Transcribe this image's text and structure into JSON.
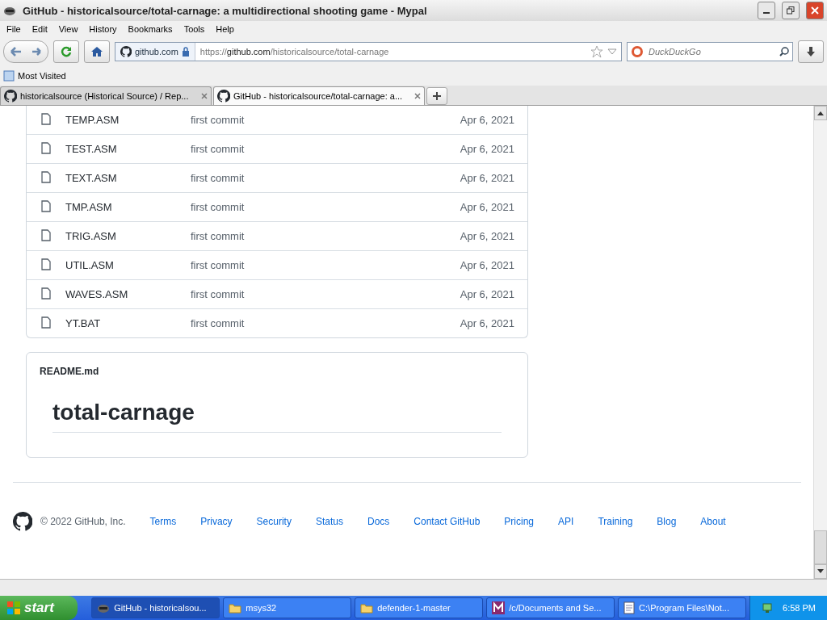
{
  "window": {
    "title": "GitHub - historicalsource/total-carnage: a multidirectional shooting game - Mypal"
  },
  "menu": [
    "File",
    "Edit",
    "View",
    "History",
    "Bookmarks",
    "Tools",
    "Help"
  ],
  "address": {
    "site": "github.com",
    "url_prefix": "https://",
    "url_host": "github.com",
    "url_path": "/historicalsource/total-carnage"
  },
  "search": {
    "placeholder": "DuckDuckGo"
  },
  "bookmarks": [
    "Most Visited"
  ],
  "tabs": [
    {
      "label": "historicalsource (Historical Source) / Rep...",
      "selected": false
    },
    {
      "label": "GitHub - historicalsource/total-carnage: a...",
      "selected": true
    }
  ],
  "files": [
    {
      "name": "TEMP.ASM",
      "message": "first commit",
      "date": "Apr 6, 2021"
    },
    {
      "name": "TEST.ASM",
      "message": "first commit",
      "date": "Apr 6, 2021"
    },
    {
      "name": "TEXT.ASM",
      "message": "first commit",
      "date": "Apr 6, 2021"
    },
    {
      "name": "TMP.ASM",
      "message": "first commit",
      "date": "Apr 6, 2021"
    },
    {
      "name": "TRIG.ASM",
      "message": "first commit",
      "date": "Apr 6, 2021"
    },
    {
      "name": "UTIL.ASM",
      "message": "first commit",
      "date": "Apr 6, 2021"
    },
    {
      "name": "WAVES.ASM",
      "message": "first commit",
      "date": "Apr 6, 2021"
    },
    {
      "name": "YT.BAT",
      "message": "first commit",
      "date": "Apr 6, 2021"
    }
  ],
  "readme": {
    "filename": "README.md",
    "heading": "total-carnage"
  },
  "footer": {
    "copyright": "© 2022 GitHub, Inc.",
    "links": [
      "Terms",
      "Privacy",
      "Security",
      "Status",
      "Docs",
      "Contact GitHub",
      "Pricing",
      "API",
      "Training",
      "Blog",
      "About"
    ]
  },
  "taskbar": {
    "start": "start",
    "items": [
      {
        "label": "GitHub - historicalsou...",
        "kind": "browser",
        "selected": true
      },
      {
        "label": "msys32",
        "kind": "folder",
        "selected": false
      },
      {
        "label": "defender-1-master",
        "kind": "folder",
        "selected": false
      },
      {
        "label": "/c/Documents and Se...",
        "kind": "terminal",
        "selected": false
      },
      {
        "label": "C:\\Program Files\\Not...",
        "kind": "editor",
        "selected": false
      }
    ],
    "clock": "6:58 PM"
  }
}
